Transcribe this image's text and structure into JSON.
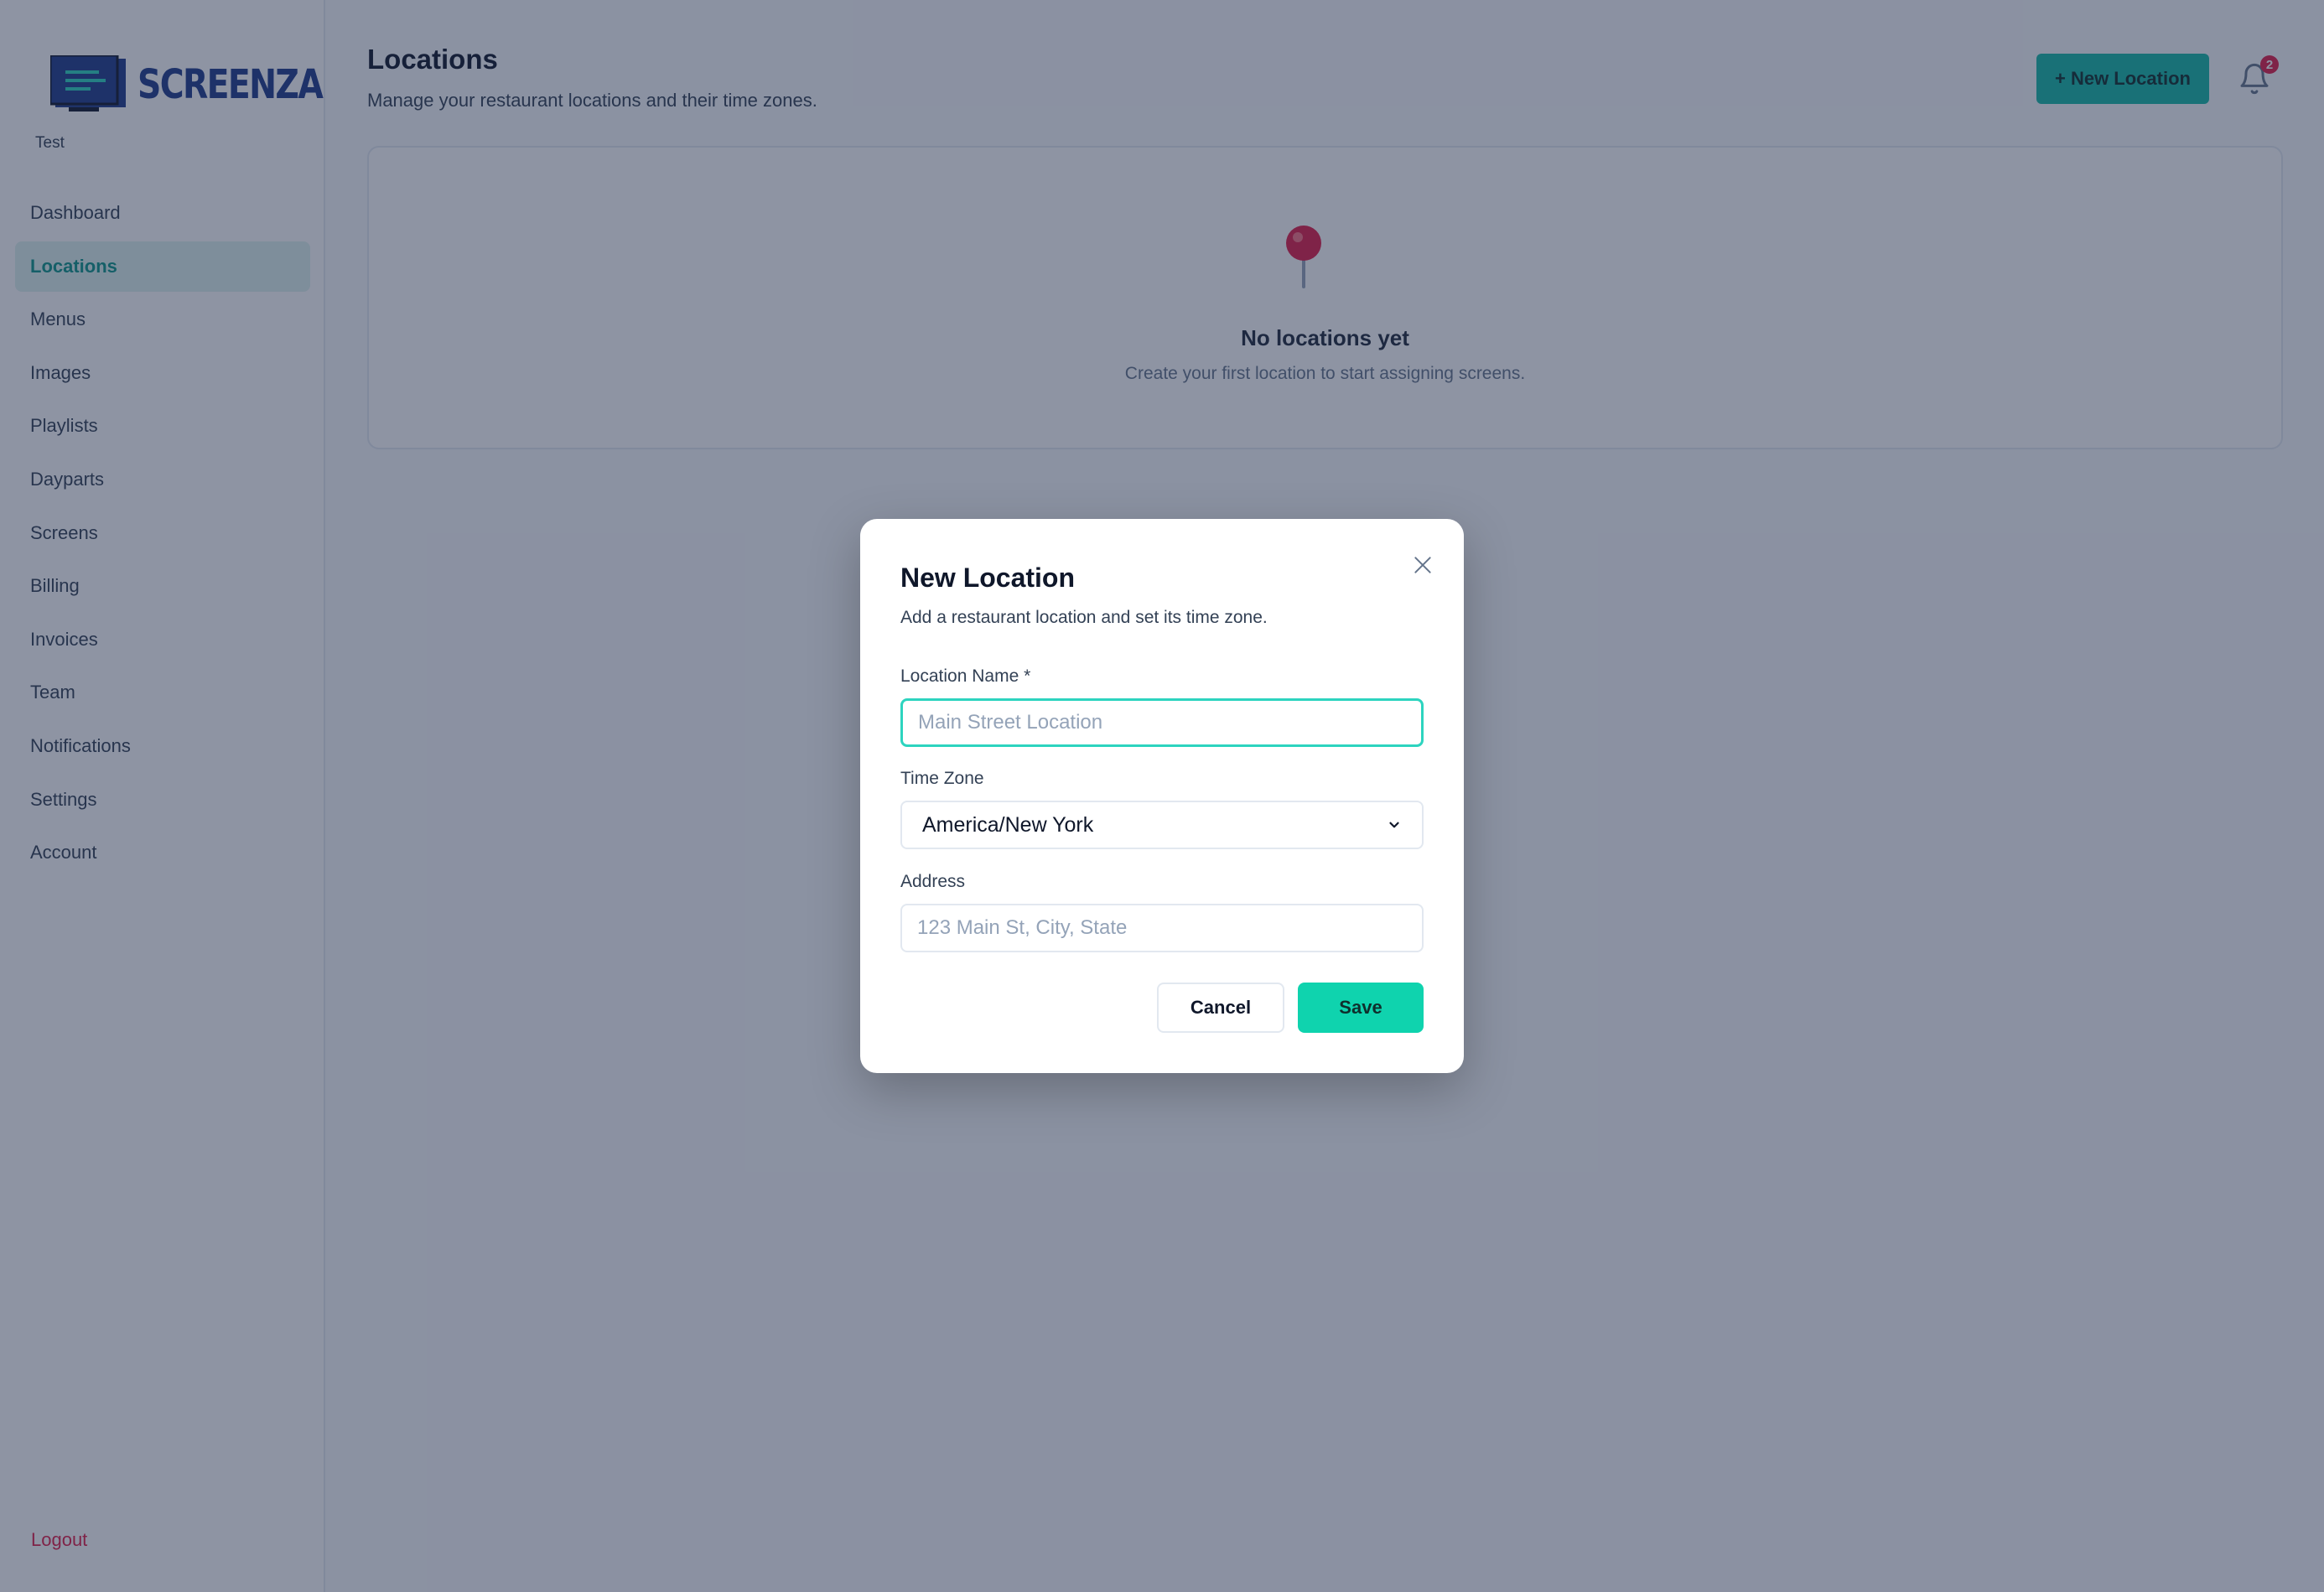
{
  "app": {
    "brand": "SCREENZA",
    "tenant": "Test"
  },
  "sidebar": {
    "items": [
      {
        "label": "Dashboard",
        "active": false
      },
      {
        "label": "Locations",
        "active": true
      },
      {
        "label": "Menus",
        "active": false
      },
      {
        "label": "Images",
        "active": false
      },
      {
        "label": "Playlists",
        "active": false
      },
      {
        "label": "Dayparts",
        "active": false
      },
      {
        "label": "Screens",
        "active": false
      },
      {
        "label": "Billing",
        "active": false
      },
      {
        "label": "Invoices",
        "active": false
      },
      {
        "label": "Team",
        "active": false
      },
      {
        "label": "Notifications",
        "active": false
      },
      {
        "label": "Settings",
        "active": false
      },
      {
        "label": "Account",
        "active": false
      }
    ],
    "logout_label": "Logout"
  },
  "header": {
    "title": "Locations",
    "subtitle": "Manage your restaurant locations and their time zones.",
    "new_button_label": "+ New Location",
    "notification_count": "2",
    "notification_icon": "bell-icon"
  },
  "empty_state": {
    "icon": "pin-icon",
    "title": "No locations yet",
    "description": "Create your first location to start assigning screens."
  },
  "modal": {
    "title": "New Location",
    "description": "Add a restaurant location and set its time zone.",
    "close_icon": "close-icon",
    "fields": {
      "name": {
        "label": "Location Name *",
        "value": "",
        "placeholder": "Main Street Location"
      },
      "timezone": {
        "label": "Time Zone",
        "value": "America/New York"
      },
      "address": {
        "label": "Address",
        "value": "",
        "placeholder": "123 Main St, City, State"
      }
    },
    "cancel_label": "Cancel",
    "save_label": "Save"
  },
  "colors": {
    "accent": "#14b8a6",
    "accent_active_bg": "#dff3ee",
    "save_button": "#0fd3ae",
    "logout": "#e11d48",
    "badge": "#e11d48",
    "brand_navy": "#1e3a8a"
  }
}
